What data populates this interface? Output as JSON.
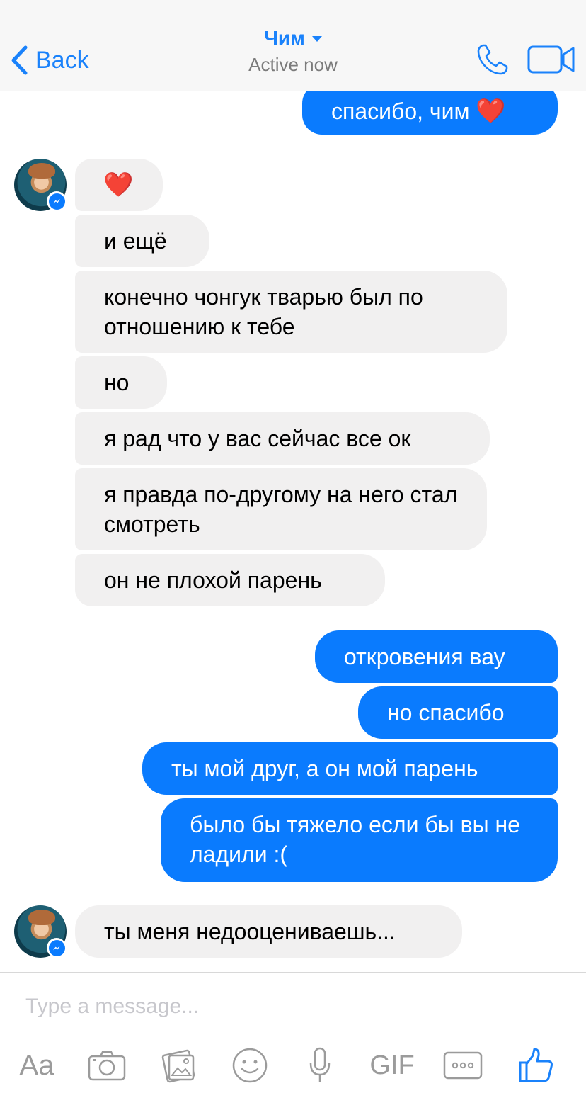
{
  "header": {
    "back_label": "Back",
    "contact_name": "Чим",
    "status": "Active now"
  },
  "icons": {
    "back": "chevron-left-icon",
    "call": "phone-icon",
    "video": "video-camera-icon",
    "badge": "messenger-icon"
  },
  "colors": {
    "accent": "#1a82fb",
    "outgoing_bubble": "#0a7bfe",
    "incoming_bubble": "#f1f0f0"
  },
  "messages": [
    {
      "from": "me",
      "text": "спасибо, чим",
      "emoji": "❤️"
    },
    {
      "from": "them",
      "text": "",
      "emoji": "❤️"
    },
    {
      "from": "them",
      "text": "и ещё"
    },
    {
      "from": "them",
      "text": "конечно чонгук тварью был по отношению к тебе"
    },
    {
      "from": "them",
      "text": "но"
    },
    {
      "from": "them",
      "text": "я рад что у вас сейчас все ок"
    },
    {
      "from": "them",
      "text": "я правда по-другому на него стал смотреть"
    },
    {
      "from": "them",
      "text": "он не плохой парень"
    },
    {
      "from": "me",
      "text": "откровения вау"
    },
    {
      "from": "me",
      "text": "но спасибо"
    },
    {
      "from": "me",
      "text": "ты мой друг, а он мой парень"
    },
    {
      "from": "me",
      "text": "было бы тяжело если бы вы не ладили :("
    },
    {
      "from": "them",
      "text": "ты меня недооцениваешь..."
    }
  ],
  "composer": {
    "placeholder": "Type a message...",
    "text_tool_label": "Aa",
    "gif_label": "GIF"
  }
}
